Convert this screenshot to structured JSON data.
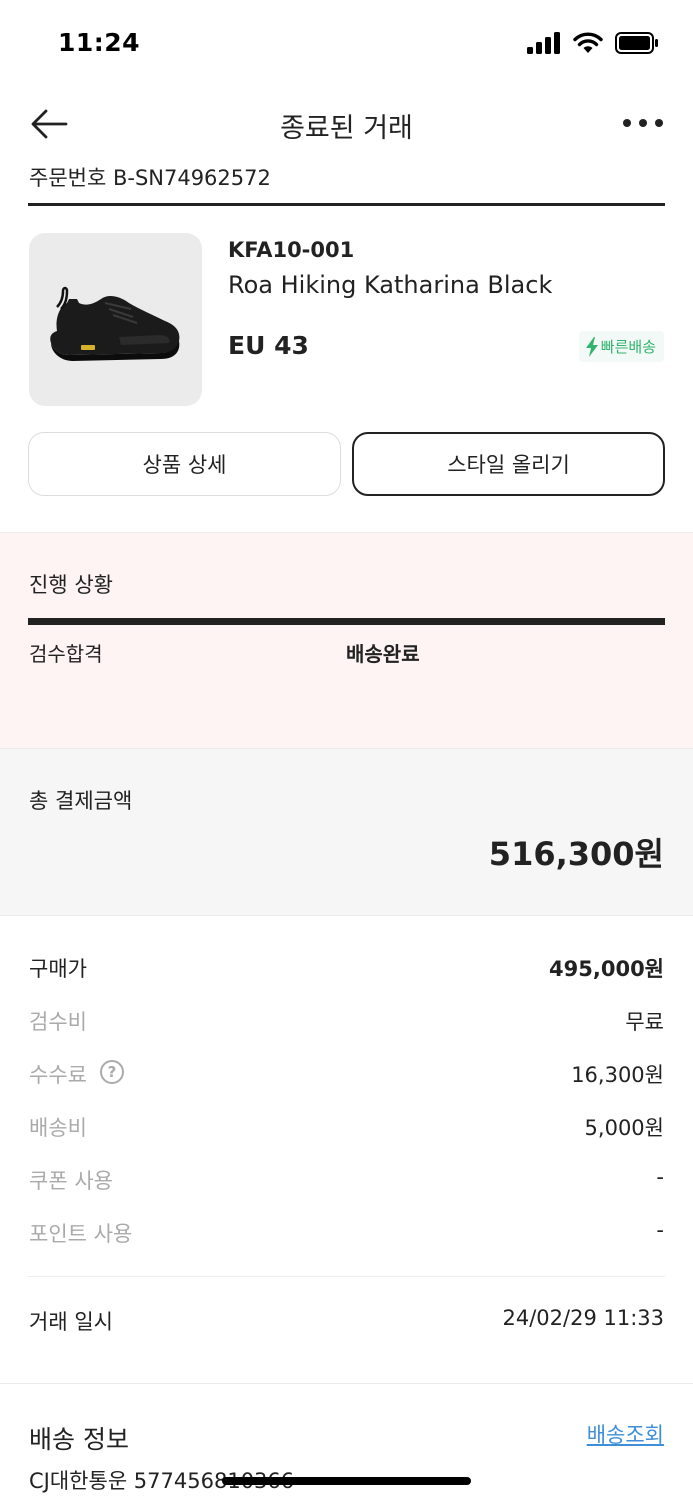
{
  "status_bar": {
    "time": "11:24"
  },
  "header": {
    "title": "종료된 거래"
  },
  "order": {
    "number": "주문번호 B-SN74962572"
  },
  "product": {
    "code": "KFA10-001",
    "name": "Roa Hiking Katharina Black",
    "size": "EU 43",
    "badge": "빠른배송",
    "badge_icon": "lightning-icon",
    "badge_color": "#31b46e"
  },
  "actions": {
    "detail_label": "상품 상세",
    "style_label": "스타일 올리기"
  },
  "progress": {
    "title": "진행 상황",
    "steps": [
      "검수합격",
      "배송완료"
    ],
    "fill": 1.0,
    "background": "#fdf4f3"
  },
  "payment": {
    "total_label": "총 결제금액",
    "total_value": "516,300원",
    "rows": [
      {
        "label": "구매가",
        "value": "495,000원"
      },
      {
        "label": "검수비",
        "value": "무료"
      },
      {
        "label": "수수료",
        "value": "16,300원",
        "help_icon": "?"
      },
      {
        "label": "배송비",
        "value": "5,000원"
      },
      {
        "label": "쿠폰 사용",
        "value": "-"
      },
      {
        "label": "포인트 사용",
        "value": "-"
      }
    ],
    "date_label": "거래 일시",
    "date_value": "24/02/29 11:33"
  },
  "delivery": {
    "title": "배송 정보",
    "track_link": "배송조회",
    "carrier": "CJ대한통운 577456810366",
    "link_color": "#3f8fd8"
  }
}
